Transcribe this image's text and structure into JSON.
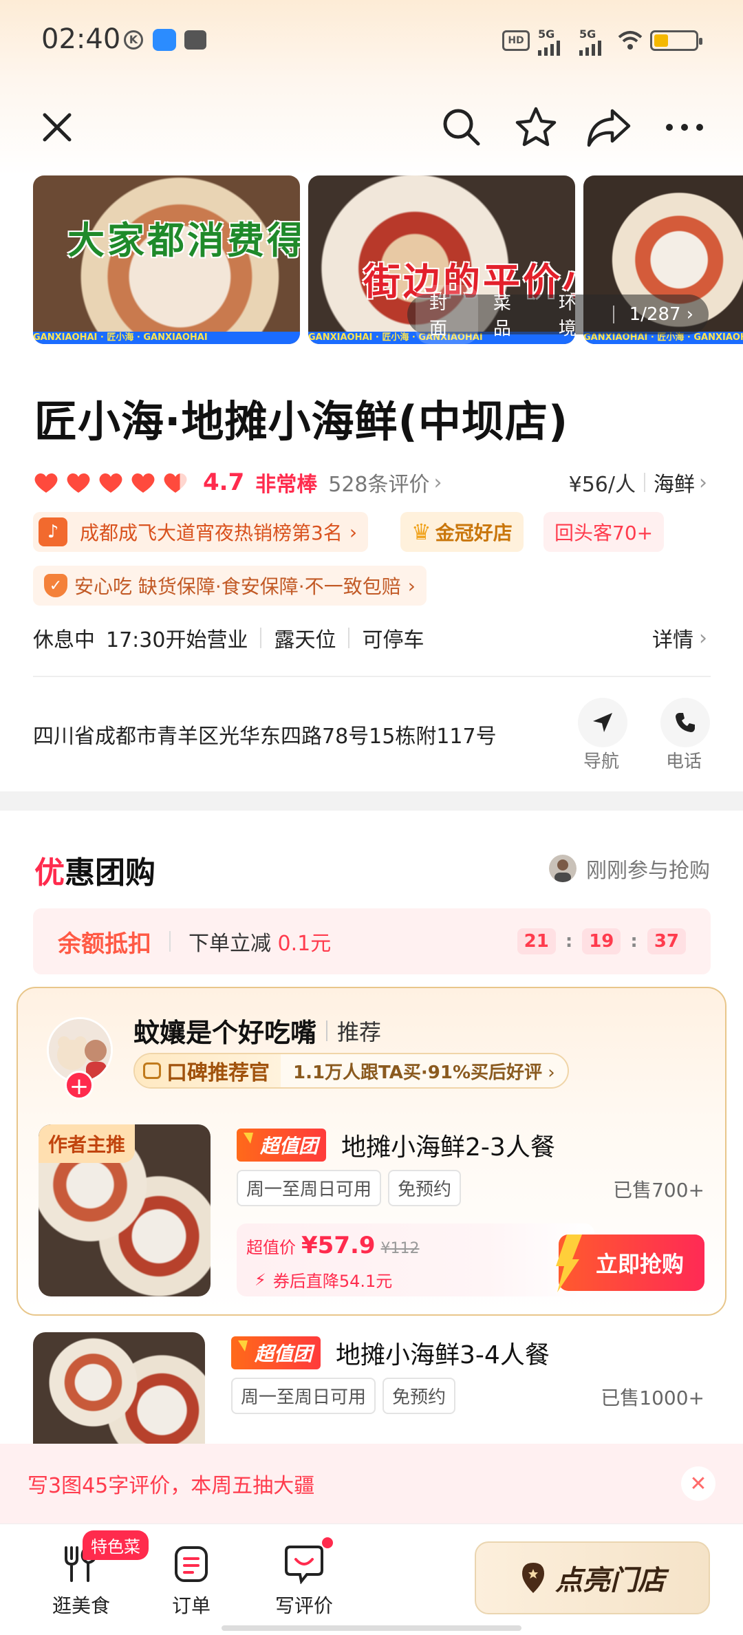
{
  "status_bar": {
    "time": "02:40",
    "network_1": "5G",
    "network_2": "5G",
    "hd": "HD"
  },
  "photos": {
    "overlay_line_1": "大家都消费得起的",
    "overlay_line_2": "街边的平价小海鲜",
    "strip_text": "GANXIAOHAI · 匠小海 · GANXIAOHAI",
    "tabs": [
      "封面",
      "菜品",
      "环境"
    ],
    "counter": "1/287"
  },
  "store": {
    "title": "匠小海·地摊小海鲜(中坝店)",
    "score": "4.7",
    "score_label": "非常棒",
    "reviews": "528条评价",
    "price_per_person": "¥56/人",
    "category": "海鲜",
    "hearts": 5
  },
  "tags": {
    "ranking": "成都成飞大道宵夜热销榜第3名",
    "crown": "金冠好店",
    "repeat": "回头客70+",
    "safety": "安心吃 缺货保障·食安保障·不一致包赔"
  },
  "info": {
    "status": "休息中",
    "open_time": "17:30开始营业",
    "outdoor": "露天位",
    "parking": "可停车",
    "details": "详情",
    "address": "四川省成都市青羊区光华东四路78号15栋附117号",
    "nav_label": "导航",
    "phone_label": "电话"
  },
  "section": {
    "title_accent": "优",
    "title_rest": "惠团购",
    "recent": "刚刚参与抢购"
  },
  "balance": {
    "label": "余额抵扣",
    "sub_prefix": "下单立减",
    "amount": "0.1元",
    "timer": [
      "21",
      "19",
      "37"
    ]
  },
  "recommender": {
    "name": "蚊孃是个好吃嘴",
    "tag": "推荐",
    "badge": "口碑推荐官",
    "stats_a": "1.1万人跟TA买",
    "stats_b": "·91%买后好评"
  },
  "deals": [
    {
      "ribbon": "作者主推",
      "badge": "超值团",
      "name": "地摊小海鲜2-3人餐",
      "chips": [
        "周一至周日可用",
        "免预约"
      ],
      "sold": "已售700+",
      "price_label": "超值价",
      "price": "¥57.9",
      "orig_price": "¥112",
      "coupon": "券后直降54.1元",
      "buy": "立即抢购"
    },
    {
      "badge": "超值团",
      "name": "地摊小海鲜3-4人餐",
      "chips": [
        "周一至周日可用",
        "免预约"
      ],
      "sold": "已售1000+"
    }
  ],
  "promo": {
    "text": "写3图45字评价，本周五抽大疆"
  },
  "bottom_nav": {
    "food": "逛美食",
    "special": "特色菜",
    "orders": "订单",
    "review": "写评价",
    "light_up": "点亮门店"
  },
  "colors": {
    "accent_red": "#ff2b4d",
    "gold_border": "#e8c68a"
  }
}
